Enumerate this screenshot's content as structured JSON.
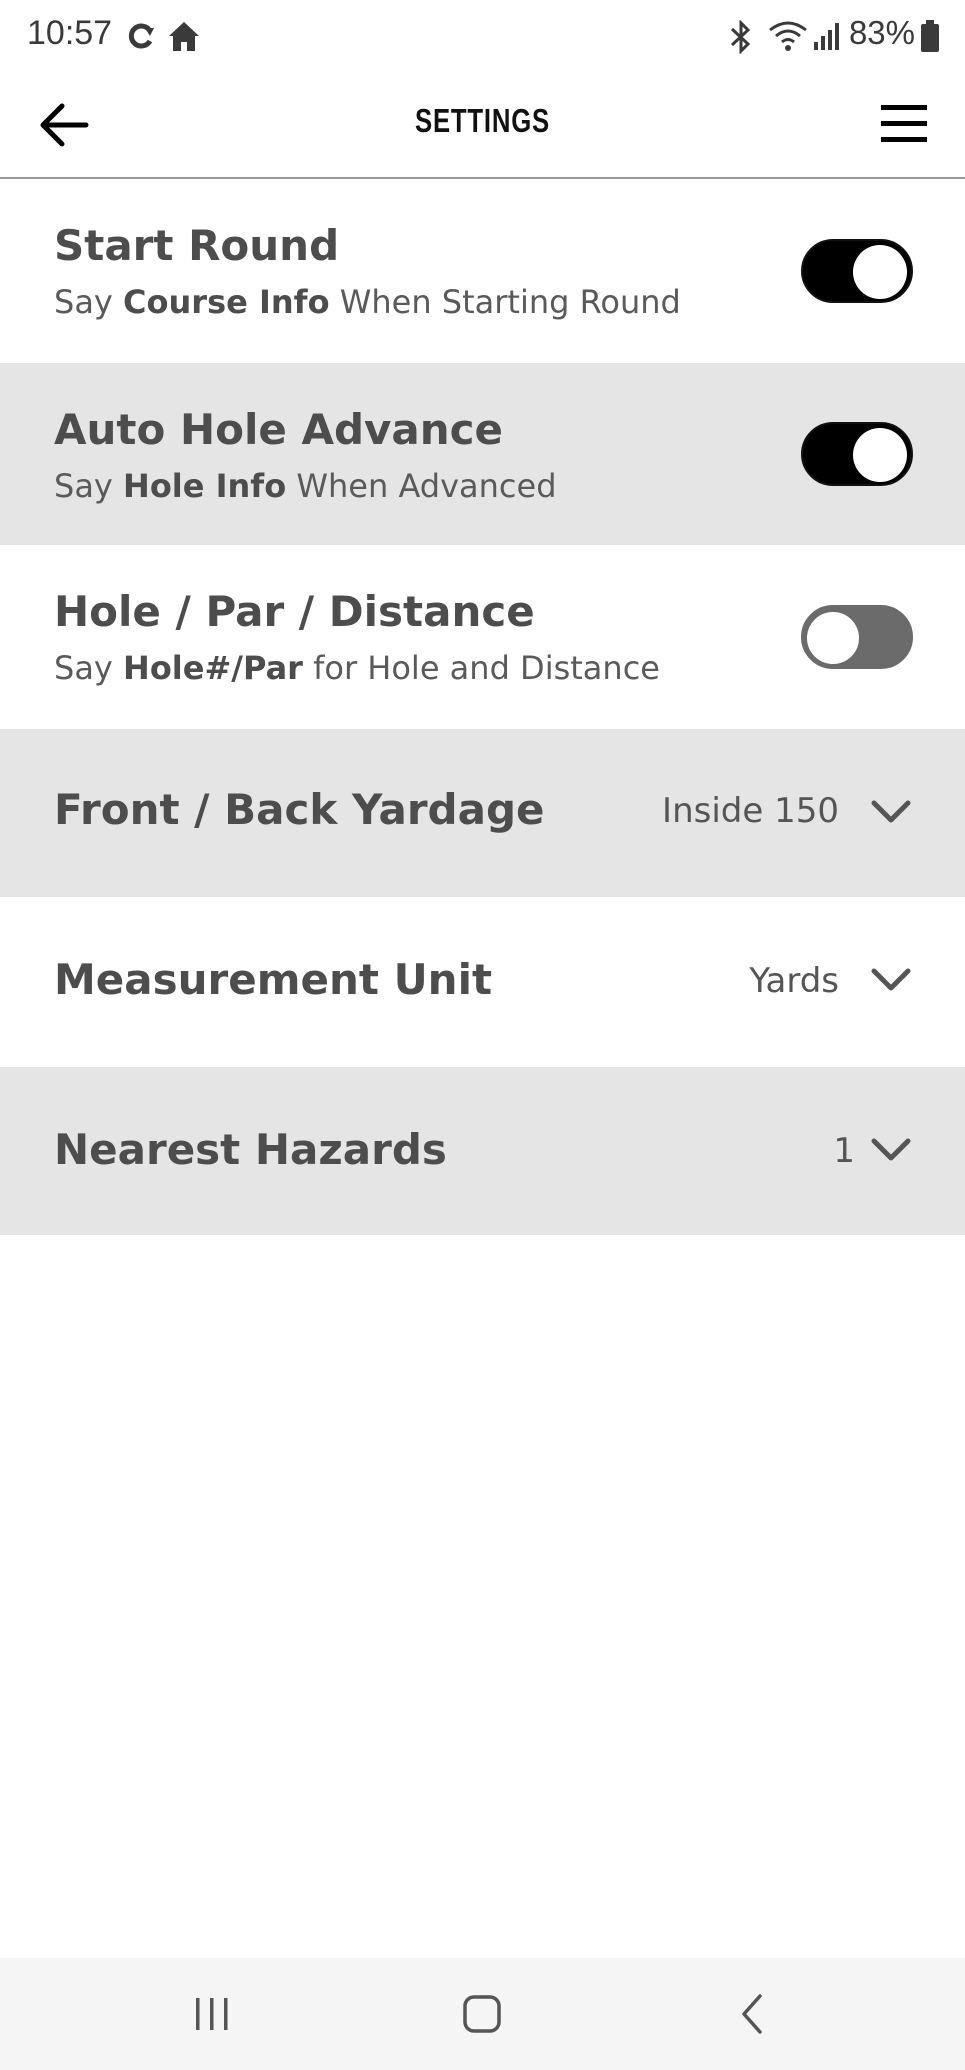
{
  "status_bar": {
    "time": "10:57",
    "battery_percent": "83%",
    "icons": [
      "sync-icon",
      "home-icon",
      "bluetooth-icon",
      "wifi-icon",
      "signal-icon",
      "battery-icon"
    ]
  },
  "header": {
    "title": "SETTINGS",
    "back_icon": "arrow-left-icon",
    "menu_icon": "hamburger-menu-icon"
  },
  "settings": {
    "start_round": {
      "title": "Start Round",
      "sub_prefix": "Say ",
      "sub_bold": "Course Info",
      "sub_suffix": " When Starting Round",
      "enabled": true
    },
    "auto_hole_advance": {
      "title": "Auto Hole Advance",
      "sub_prefix": "Say ",
      "sub_bold": "Hole Info",
      "sub_suffix": " When Advanced",
      "enabled": true
    },
    "hole_par_distance": {
      "title": "Hole / Par / Distance",
      "sub_prefix": "Say ",
      "sub_bold": "Hole#/Par",
      "sub_suffix": " for Hole and Distance",
      "enabled": false
    },
    "front_back_yardage": {
      "title": "Front / Back Yardage",
      "value": "Inside 150"
    },
    "measurement_unit": {
      "title": "Measurement Unit",
      "value": "Yards"
    },
    "nearest_hazards": {
      "title": "Nearest Hazards",
      "value": "1"
    }
  },
  "colors": {
    "row_alt_background": "#e5e5e5",
    "toggle_on": "#000000",
    "toggle_off": "#6b6b6b"
  },
  "navbar": {
    "icons": [
      "recent-apps-icon",
      "home-button-icon",
      "back-nav-icon"
    ]
  }
}
